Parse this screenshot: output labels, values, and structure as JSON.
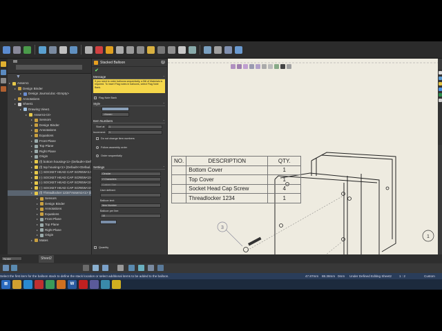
{
  "window": {
    "status_text": "Select the first item for the balloon stack to define the stack location or select additional items to be added to the balloon.",
    "measure_x": "47.87mm",
    "measure_y": "88.38mm",
    "z": "0mm",
    "status": "Under Defined",
    "editing": "Editing Sheet2",
    "scale": "1 : 2",
    "units": "Custom"
  },
  "tree": {
    "filter_label": "▼",
    "items": [
      {
        "label": "Assem1",
        "indent": 0,
        "color": "#e6c84a"
      },
      {
        "label": "Design Binder",
        "indent": 1,
        "color": "#c9a040"
      },
      {
        "label": "Design Journal.doc <Empty>",
        "indent": 2,
        "color": "#6a8ccf"
      },
      {
        "label": "Annotations",
        "indent": 1,
        "color": "#c9a040"
      },
      {
        "label": "Sheet1",
        "indent": 1,
        "color": "#cfcfcf"
      },
      {
        "label": "Drawing View1",
        "indent": 2,
        "color": "#a0c0e0"
      },
      {
        "label": "Assem1<3>",
        "indent": 3,
        "color": "#e6c84a"
      },
      {
        "label": "Sensors",
        "indent": 4,
        "color": "#c9a040"
      },
      {
        "label": "Design Binder",
        "indent": 4,
        "color": "#c9a040"
      },
      {
        "label": "Annotations",
        "indent": 4,
        "color": "#c9a040"
      },
      {
        "label": "Equations",
        "indent": 4,
        "color": "#c9a040"
      },
      {
        "label": "Front Plane",
        "indent": 4,
        "color": "#9aa"
      },
      {
        "label": "Top Plane",
        "indent": 4,
        "color": "#9aa"
      },
      {
        "label": "Right Plane",
        "indent": 4,
        "color": "#9aa"
      },
      {
        "label": "Origin",
        "indent": 4,
        "color": "#9aa"
      },
      {
        "label": "(f) bottom housing<1> (Default<<Def...",
        "indent": 4,
        "color": "#e6c84a"
      },
      {
        "label": "(f) top housing<1> (Default<<Defaul...",
        "indent": 4,
        "color": "#e6c84a"
      },
      {
        "label": "(-) SOCKET HEAD CAP SCREW<1>",
        "indent": 4,
        "color": "#e6c84a"
      },
      {
        "label": "(-) SOCKET HEAD CAP SCREW<2>",
        "indent": 4,
        "color": "#e6c84a"
      },
      {
        "label": "(-) SOCKET HEAD CAP SCREW<3>",
        "indent": 4,
        "color": "#e6c84a"
      },
      {
        "label": "(-) SOCKET HEAD CAP SCREW<4>",
        "indent": 4,
        "color": "#e6c84a"
      },
      {
        "label": "(f) Threadlocker 1234^Assem1<1> (Default<<Default>_Display State 1>)",
        "indent": 4,
        "color": "#e6c84a",
        "highlight": true
      },
      {
        "label": "Sensors",
        "indent": 5,
        "color": "#c9a040"
      },
      {
        "label": "Design Binder",
        "indent": 5,
        "color": "#c9a040"
      },
      {
        "label": "Annotations",
        "indent": 5,
        "color": "#c9a040"
      },
      {
        "label": "Equations",
        "indent": 5,
        "color": "#c9a040"
      },
      {
        "label": "Front Plane",
        "indent": 5,
        "color": "#9aa"
      },
      {
        "label": "Top Plane",
        "indent": 5,
        "color": "#9aa"
      },
      {
        "label": "Right Plane",
        "indent": 5,
        "color": "#9aa"
      },
      {
        "label": "Origin",
        "indent": 5,
        "color": "#9aa"
      },
      {
        "label": "Mates",
        "indent": 4,
        "color": "#c9a040"
      }
    ]
  },
  "balloon": {
    "title": "Stacked Balloon",
    "ok": "✔",
    "cancel": "✖",
    "help": "?",
    "message_header": "Message",
    "message": "If you need to order balloons sequentially, a Bill of Materials is required.\nTo insert Flag notes in balloons, select Flag Note Bank.",
    "flag_note_bank": "Flag Note Bank",
    "style_header": "Style",
    "style_value": "<None>",
    "item_numbers_header": "Item Numbers",
    "start_at_label": "Start at:",
    "start_at_value": "1",
    "increment_label": "Increment:",
    "increment_value": "1",
    "do_not_change": "Do not change item numbers",
    "follow_assembly": "Follow assembly order",
    "order_seq": "Order sequentially",
    "settings_header": "Settings",
    "settings_style": "Circular",
    "settings_size": "2 Characters",
    "custom_size": "Custom Size",
    "user_defined_label": "User defined:",
    "user_defined_value": "",
    "balloon_text_label": "Balloon text:",
    "balloon_text_value": "Item Number",
    "lower_text_label": "Balloon per line:",
    "lower_text_value": "10",
    "quantity": "Quantity"
  },
  "bom": {
    "headers": [
      "NO.",
      "DESCRIPTION",
      "QTY."
    ],
    "rows": [
      [
        "",
        "Bottom Cover",
        "1"
      ],
      [
        "",
        "Top Cover",
        "1"
      ],
      [
        "",
        "Socket Head Cap Screw",
        "4"
      ],
      [
        "",
        "Threadlocker 1234",
        "1"
      ]
    ]
  },
  "drawing": {
    "balloon_left": "3",
    "balloon_right": "1"
  },
  "sheet": {
    "tab": "Sheet2",
    "state": "None"
  },
  "colors": {
    "toolbar_bg": "#2b2b2b",
    "panel_bg": "#3c3c3c",
    "paper": "#eeebe0",
    "message_bg": "#f5d74a",
    "status_bar": "#2a3d5a"
  }
}
